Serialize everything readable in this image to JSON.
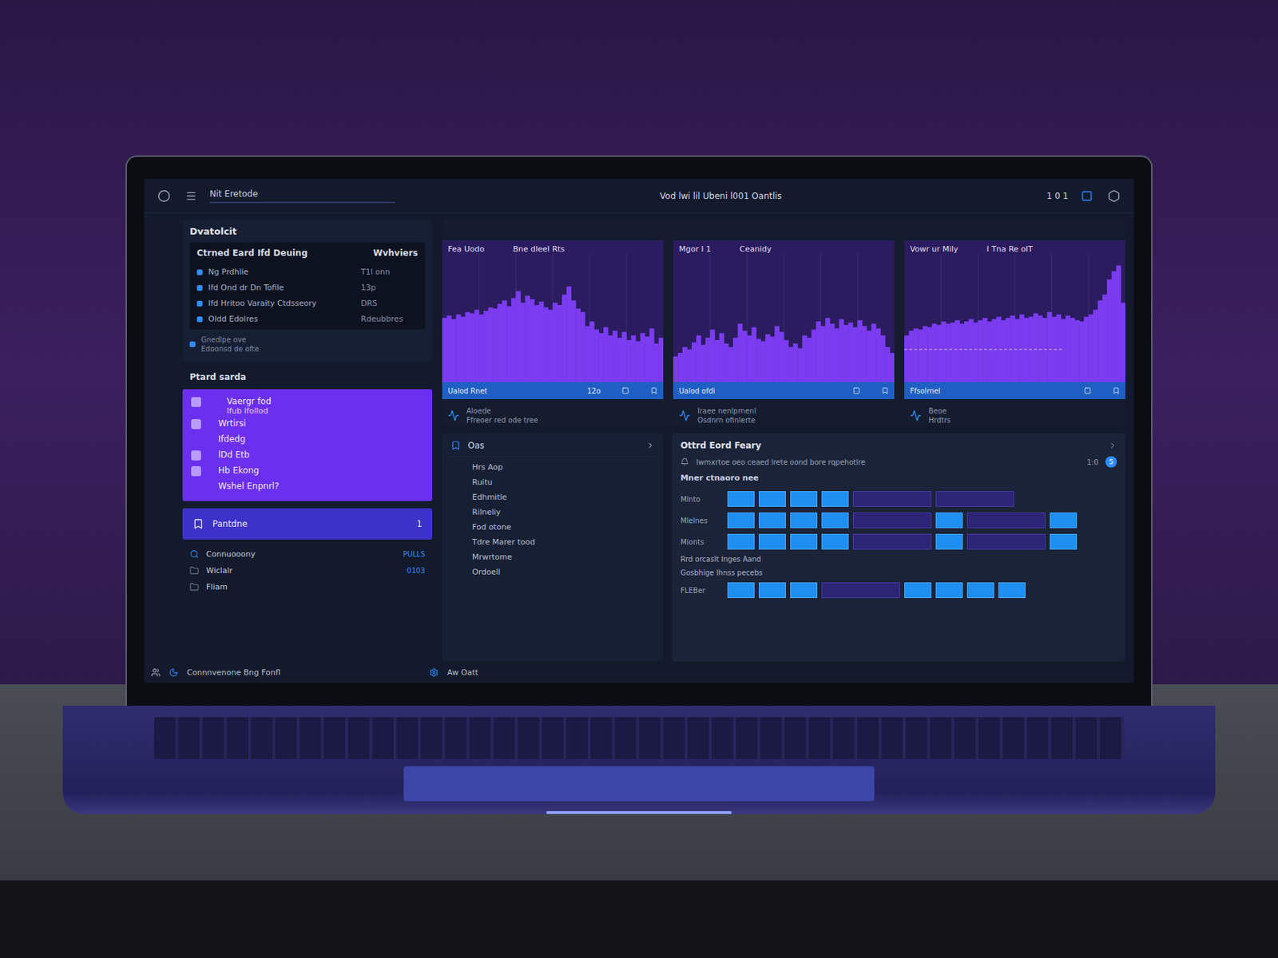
{
  "window": {
    "title": "Vod lwi lil Ubeni l001 Oantlis"
  },
  "topbar": {
    "label": "Nit Eretode",
    "counter": "1 0 1"
  },
  "summary_panel": {
    "title": "Dvatolcit",
    "columns": [
      "Ctrned Eard Ifd Deuing",
      "Wvhviers"
    ],
    "rows": [
      {
        "label": "Ng Prdhlie",
        "value": "T1l onn"
      },
      {
        "label": "Ifd Ond dr Dn Tofile",
        "value": "13p"
      },
      {
        "label": "Ifd Hritoo Varaity Ctdsseory",
        "value": "DRS"
      },
      {
        "label": "Oldd Edolres",
        "value": "Rdeubbres"
      }
    ],
    "footer": [
      "Gnedlpe ove",
      "Edoonsd de ofte"
    ]
  },
  "section": {
    "title": "Ptard sarda"
  },
  "menu": [
    {
      "label": "Vaergr fod",
      "sub": "Ifub lfollod",
      "kind": "icon"
    },
    {
      "label": "Wrtirsi",
      "kind": "icon"
    },
    {
      "label": "Ifdedg",
      "kind": "plain"
    },
    {
      "label": "lDd Etb",
      "kind": "icon"
    },
    {
      "label": "Hb Ekong",
      "kind": "icon"
    },
    {
      "label": "Wshel Enpnrl?",
      "kind": "plain"
    }
  ],
  "primary_button": {
    "label": "Pantdne",
    "badge": "1"
  },
  "nav_list": [
    {
      "label": "Connuooony",
      "value": "PULLS"
    },
    {
      "label": "Wiclalr",
      "value": "0103"
    },
    {
      "label": "Fliam"
    }
  ],
  "charts": [
    {
      "titles": [
        "Fea Uodo",
        "Bne dleel Rts"
      ],
      "footer": "Ualod Rnet",
      "footer_value": "12o",
      "caption": [
        "Aloede",
        "Ffreoer red ode tree"
      ],
      "values": [
        55,
        57,
        54,
        58,
        56,
        60,
        59,
        62,
        58,
        61,
        64,
        63,
        67,
        70,
        65,
        72,
        78,
        68,
        74,
        71,
        66,
        69,
        64,
        62,
        68,
        66,
        75,
        82,
        70,
        63,
        60,
        48,
        52,
        45,
        42,
        47,
        40,
        44,
        38,
        43,
        36,
        40,
        35,
        42,
        39,
        46,
        33,
        38
      ]
    },
    {
      "titles": [
        "Mgor I 1",
        "Ceanidy"
      ],
      "footer": "Ualod ofdi",
      "footer_value": "",
      "caption": [
        "Iraee nenlprnenl",
        "Osdnrn ofinlerte"
      ],
      "values": [
        22,
        25,
        30,
        28,
        34,
        40,
        32,
        38,
        45,
        36,
        42,
        33,
        30,
        38,
        50,
        44,
        40,
        47,
        37,
        35,
        41,
        39,
        48,
        43,
        36,
        30,
        33,
        29,
        40,
        38,
        45,
        52,
        48,
        55,
        50,
        46,
        54,
        49,
        51,
        47,
        53,
        48,
        44,
        50,
        46,
        40,
        30,
        25
      ]
    },
    {
      "titles": [
        "Vowr ur Mily",
        "I Tna Re oIT"
      ],
      "footer": "Ffsolrnel",
      "footer_value": "",
      "caption": [
        "Beoe",
        "Hrdtrs"
      ],
      "reference": 28,
      "values": [
        40,
        44,
        46,
        45,
        48,
        47,
        50,
        49,
        52,
        50,
        51,
        53,
        50,
        52,
        54,
        51,
        53,
        55,
        52,
        54,
        56,
        53,
        55,
        57,
        54,
        58,
        55,
        56,
        59,
        57,
        55,
        60,
        56,
        58,
        54,
        57,
        55,
        53,
        52,
        56,
        58,
        62,
        70,
        75,
        88,
        95,
        100,
        68
      ]
    }
  ],
  "list_panel": {
    "title": "Oas",
    "items": [
      "Hrs Aop",
      "Ruitu",
      "Edhmitle",
      "Rilneliy",
      "Fod otone",
      "Tdre Marer tood",
      "Mrwrtome",
      "Ordoell"
    ]
  },
  "grid_panel": {
    "title": "Ottrd Eord Feary",
    "subtitle": "Iwmxrtoe oeo ceaed lrete oond bore rqpehotlre",
    "count": "1:0",
    "badge": "5",
    "section": "Mner ctnaoro nee",
    "rows": [
      {
        "label": "Mlnto",
        "cells": [
          {
            "kind": "block",
            "color": "#1e8ef0"
          },
          {
            "kind": "block",
            "color": "#1e8ef0"
          },
          {
            "kind": "block",
            "color": "#1e8ef0"
          },
          {
            "kind": "block",
            "color": "#1e8ef0"
          },
          {
            "kind": "wide",
            "color": "#2c2475"
          },
          {
            "kind": "wide",
            "color": "#2c2475"
          }
        ]
      },
      {
        "label": "Mlelnes",
        "cells": [
          {
            "kind": "block",
            "color": "#1e8ef0"
          },
          {
            "kind": "block",
            "color": "#1e8ef0"
          },
          {
            "kind": "block",
            "color": "#1e8ef0"
          },
          {
            "kind": "block",
            "color": "#1e8ef0"
          },
          {
            "kind": "wide",
            "color": "#2c2475"
          },
          {
            "kind": "block",
            "color": "#1e8ef0"
          },
          {
            "kind": "wide",
            "color": "#2c2475"
          },
          {
            "kind": "block",
            "color": "#1e8ef0"
          }
        ]
      },
      {
        "label": "Mionts",
        "cells": [
          {
            "kind": "block",
            "color": "#1e8ef0"
          },
          {
            "kind": "block",
            "color": "#1e8ef0"
          },
          {
            "kind": "block",
            "color": "#1e8ef0"
          },
          {
            "kind": "block",
            "color": "#1e8ef0"
          },
          {
            "kind": "wide",
            "color": "#2c2475"
          },
          {
            "kind": "block",
            "color": "#1e8ef0"
          },
          {
            "kind": "wide",
            "color": "#2c2475"
          },
          {
            "kind": "block",
            "color": "#1e8ef0"
          }
        ]
      }
    ],
    "notes": [
      "Rrd orcaslt Inges Aand",
      "Gosbhige Ihnss pecebs"
    ],
    "last_row": {
      "label": "FLEBer",
      "cells": [
        {
          "kind": "block",
          "color": "#1e8ef0"
        },
        {
          "kind": "block",
          "color": "#1e8ef0"
        },
        {
          "kind": "block",
          "color": "#1e8ef0"
        },
        {
          "kind": "wide",
          "color": "#2c2475"
        },
        {
          "kind": "block",
          "color": "#1e8ef0"
        },
        {
          "kind": "block",
          "color": "#1e8ef0"
        },
        {
          "kind": "block",
          "color": "#1e8ef0"
        },
        {
          "kind": "block",
          "color": "#1e8ef0"
        }
      ]
    }
  },
  "status_bar": {
    "left": "Connnvenone Bng Fonfl",
    "right": "Aw Oatt"
  }
}
